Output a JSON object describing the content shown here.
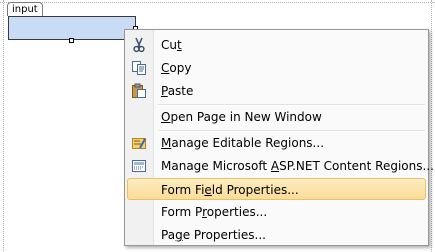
{
  "design_surface": {
    "tag_label": "input"
  },
  "context_menu": {
    "items": [
      {
        "key": "cut",
        "pre": "Cu",
        "accel": "t",
        "post": "",
        "icon": "scissors-icon"
      },
      {
        "key": "copy",
        "pre": "",
        "accel": "C",
        "post": "opy",
        "icon": "copy-icon"
      },
      {
        "key": "paste",
        "pre": "",
        "accel": "P",
        "post": "aste",
        "icon": "paste-icon"
      },
      {
        "key": "open_page_new_window",
        "pre": "",
        "accel": "O",
        "post": "pen Page in New Window",
        "icon": ""
      },
      {
        "key": "manage_editable_regions",
        "pre": "",
        "accel": "M",
        "post": "anage Editable Regions...",
        "icon": "editable-regions-icon"
      },
      {
        "key": "manage_content_regions",
        "pre": "Manage Microsoft ",
        "accel": "A",
        "post": "SP.NET Content Regions...",
        "icon": "content-regions-icon"
      },
      {
        "key": "form_field_properties",
        "pre": "Form Fi",
        "accel": "e",
        "post": "ld Properties...",
        "icon": "",
        "highlighted": true
      },
      {
        "key": "form_properties",
        "pre": "Form P",
        "accel": "r",
        "post": "operties...",
        "icon": ""
      },
      {
        "key": "page_properties",
        "pre": "Pa",
        "accel": "g",
        "post": "e Properties...",
        "icon": ""
      }
    ]
  },
  "colors": {
    "highlight": "#fbdc98",
    "input_fill": "#c8dcf6",
    "menu_background": "#fafafa"
  }
}
